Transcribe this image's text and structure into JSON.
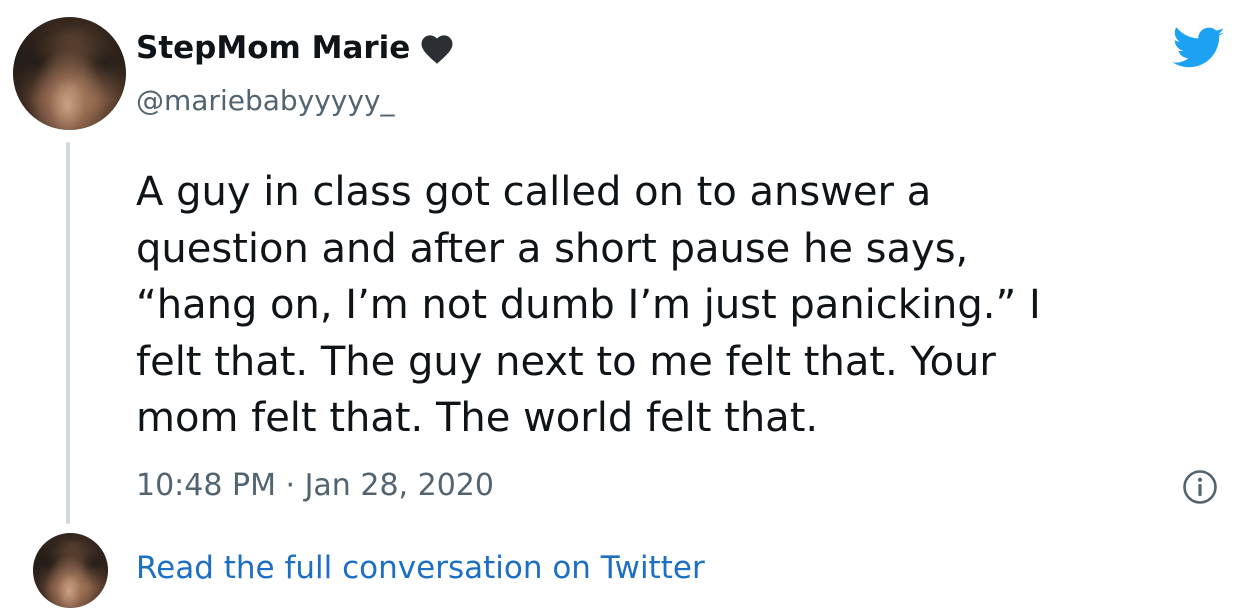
{
  "tweet": {
    "author_name": "StepMom Marie",
    "author_handle": "@mariebabyyyyy_",
    "text": "A guy in class got called on to answer a\nquestion and after a short pause he says,\n“hang on, I’m not dumb I’m just panicking.” I\nfelt that. The guy next to me felt that. Your\nmom felt that. The world felt that.",
    "timestamp": "10:48 PM · Jan 28, 2020",
    "read_more_label": "Read the full conversation on Twitter"
  },
  "icons": {
    "verified_emoji": "black-heart-icon",
    "brand": "twitter-bird-icon",
    "info": "info-icon"
  },
  "colors": {
    "twitter_blue": "#1da1f2",
    "link_blue": "#1d6fc4",
    "secondary_text": "#536471",
    "thread_line": "#cfd9de"
  }
}
